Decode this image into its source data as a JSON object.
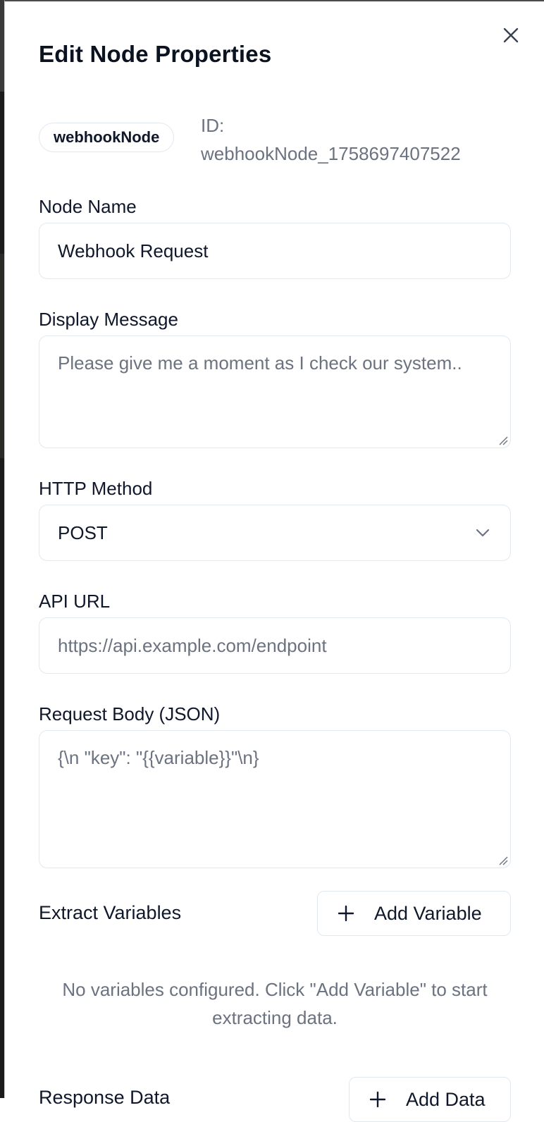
{
  "dialog": {
    "title": "Edit Node Properties",
    "node_type": "webhookNode",
    "node_id_label": "ID:",
    "node_id": "webhookNode_1758697407522"
  },
  "fields": {
    "node_name": {
      "label": "Node Name",
      "value": "Webhook Request"
    },
    "display_message": {
      "label": "Display Message",
      "placeholder": "Please give me a moment as I check our system.."
    },
    "http_method": {
      "label": "HTTP Method",
      "value": "POST"
    },
    "api_url": {
      "label": "API URL",
      "placeholder": "https://api.example.com/endpoint"
    },
    "request_body": {
      "label": "Request Body (JSON)",
      "placeholder": "{\\n  \"key\": \"{{variable}}\"\\n}"
    }
  },
  "extract_variables": {
    "label": "Extract Variables",
    "add_label": "Add Variable",
    "empty_message": "No variables configured. Click \"Add Variable\" to start extracting data."
  },
  "response_data": {
    "label": "Response Data",
    "add_label": "Add Data"
  },
  "icons": {
    "close": "close-icon",
    "chevron": "chevron-down-icon",
    "plus": "plus-icon"
  }
}
